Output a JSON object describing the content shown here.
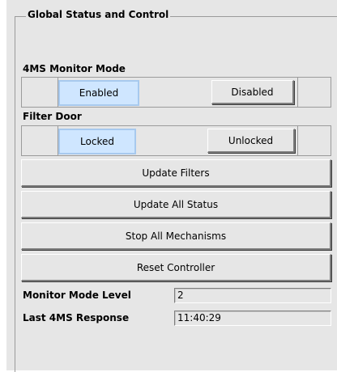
{
  "group": {
    "title": "Global Status and Control"
  },
  "monitor_mode": {
    "label": "4MS Monitor Mode",
    "options": [
      "Enabled",
      "Disabled"
    ],
    "selected": "Enabled"
  },
  "filter_door": {
    "label": "Filter Door",
    "options": [
      "Locked",
      "Unlocked"
    ],
    "selected": "Locked"
  },
  "actions": {
    "update_filters": "Update Filters",
    "update_all_status": "Update All Status",
    "stop_all_mechanisms": "Stop All Mechanisms",
    "reset_controller": "Reset Controller"
  },
  "fields": {
    "monitor_mode_level": {
      "label": "Monitor Mode Level",
      "value": "2"
    },
    "last_response": {
      "label": "Last 4MS Response",
      "value": "11:40:29"
    }
  },
  "colors": {
    "panel_bg": "#e6e6e6",
    "selected_bg": "#cfe6ff"
  }
}
